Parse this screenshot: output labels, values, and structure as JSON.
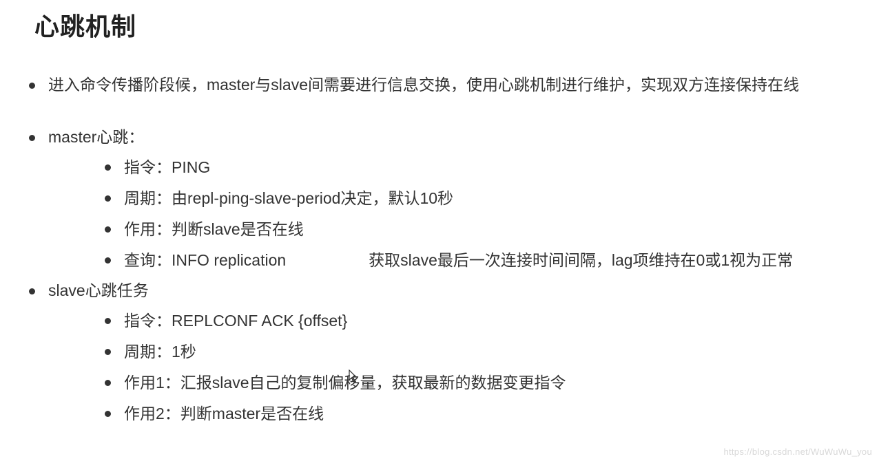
{
  "title": "心跳机制",
  "intro": "进入命令传播阶段候，master与slave间需要进行信息交换，使用心跳机制进行维护，实现双方连接保持在线",
  "master": {
    "heading": "master心跳：",
    "items": [
      "指令：PING",
      "周期：由repl-ping-slave-period决定，默认10秒",
      "作用：判断slave是否在线"
    ],
    "query_label": "查询：INFO replication",
    "query_desc": "获取slave最后一次连接时间间隔，lag项维持在0或1视为正常"
  },
  "slave": {
    "heading": "slave心跳任务",
    "items": [
      "指令：REPLCONF ACK {offset}",
      "周期：1秒",
      "作用1：汇报slave自己的复制偏移量，获取最新的数据变更指令",
      "作用2：判断master是否在线"
    ]
  },
  "watermark": "https://blog.csdn.net/WuWuWu_you"
}
